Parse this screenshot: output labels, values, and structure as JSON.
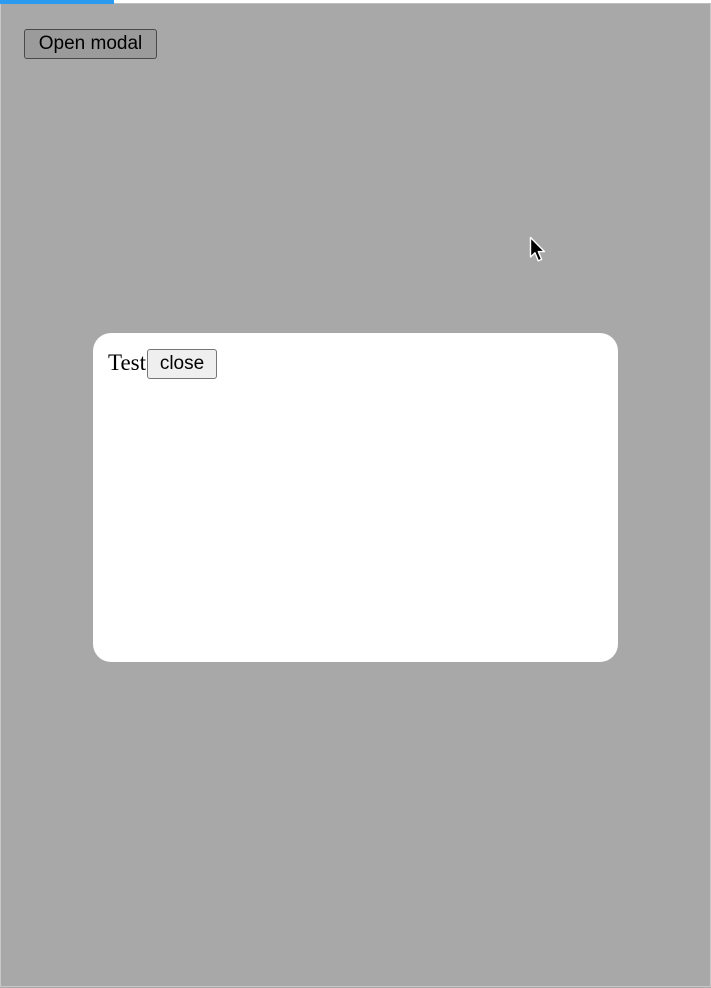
{
  "loading_bar": {
    "progress": 0.16,
    "color": "#2a9bf0"
  },
  "toolbar": {
    "open_label": "Open modal"
  },
  "modal": {
    "title": "Test",
    "close_label": "close"
  },
  "colors": {
    "overlay": "#a8a8a8",
    "modal_background": "#ffffff"
  }
}
